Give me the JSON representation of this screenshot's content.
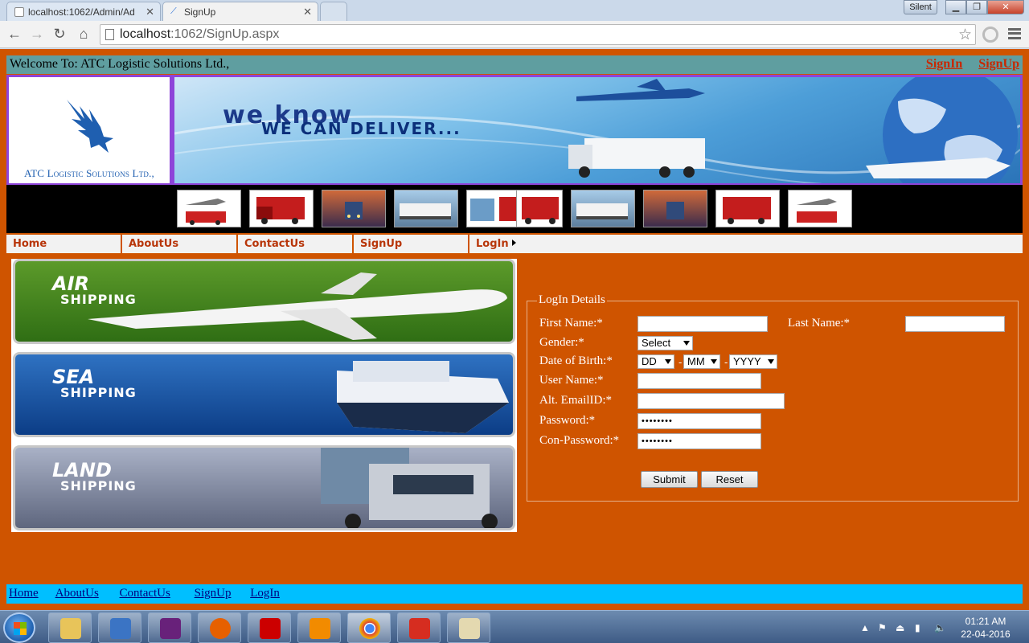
{
  "browser": {
    "tabs": [
      {
        "title": "localhost:1062/Admin/Ad"
      },
      {
        "title": "SignUp"
      }
    ],
    "silent_label": "Silent",
    "address": {
      "host": "localhost",
      "path": ":1062/SignUp.aspx"
    }
  },
  "header": {
    "welcome": "Welcome To: ATC Logistic Solutions Ltd.,",
    "signin_link": "SignIn",
    "signup_link": "SignUp"
  },
  "logo": {
    "text": "ATC Logistic Solutions Ltd.,"
  },
  "banner": {
    "line1": "we know",
    "line2": "WE CAN DELIVER..."
  },
  "menu": {
    "items": [
      {
        "label": "Home"
      },
      {
        "label": "AboutUs"
      },
      {
        "label": "ContactUs"
      },
      {
        "label": "SignUp"
      },
      {
        "label": "LogIn"
      }
    ]
  },
  "shipping": {
    "air": {
      "word": "AIR",
      "sub": "SHIPPING"
    },
    "sea": {
      "word": "SEA",
      "sub": "SHIPPING"
    },
    "land": {
      "word": "LAND",
      "sub": "SHIPPING"
    }
  },
  "form": {
    "legend": "LogIn Details",
    "first_name_label": "First Name:*",
    "last_name_label": "Last Name:*",
    "gender_label": "Gender:*",
    "gender_value": "Select",
    "dob_label": "Date of Birth:*",
    "dob_day": "DD",
    "dob_month": "MM",
    "dob_year": "YYYY",
    "dob_sep": "-",
    "username_label": "User Name:*",
    "email_label": "Alt. EmailID:*",
    "password_label": "Password:*",
    "password_value": "••••••••",
    "confirm_label": "Con-Password:*",
    "confirm_value": "••••••••",
    "submit": "Submit",
    "reset": "Reset"
  },
  "footer": {
    "links": [
      {
        "label": "Home"
      },
      {
        "label": "AboutUs"
      },
      {
        "label": "ContactUs"
      },
      {
        "label": "SignUp"
      },
      {
        "label": "LogIn"
      }
    ]
  },
  "taskbar": {
    "apps": [
      "file-explorer-icon",
      "media-player-icon",
      "visual-studio-icon",
      "firefox-icon",
      "acrobat-icon",
      "vlc-icon",
      "chrome-icon",
      "ccleaner-icon",
      "paint-icon"
    ],
    "time": "01:21 AM",
    "date": "22-04-2016"
  },
  "colors": {
    "page_bg": "#cf5400",
    "welcome_bar": "#5f9ea0",
    "footer_bar": "#00bfff",
    "accent_border": "#8e44d9",
    "link_red": "#c82800"
  }
}
